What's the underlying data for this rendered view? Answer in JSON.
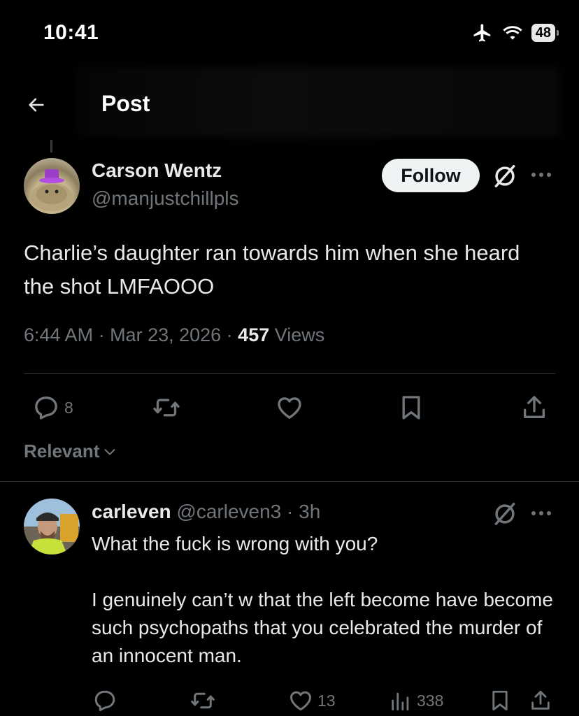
{
  "status_bar": {
    "time": "10:41",
    "battery": "48"
  },
  "header": {
    "title": "Post"
  },
  "post": {
    "author_name": "Carson Wentz",
    "author_handle": "@manjustchillpls",
    "follow_label": "Follow",
    "text": "Charlie’s daughter ran towards him when she heard the shot LMFAOOO",
    "time": "6:44 AM",
    "date": "Mar 23, 2026",
    "views_count": "457",
    "views_label": "Views",
    "reply_count": "8"
  },
  "filter": {
    "label": "Relevant"
  },
  "reply": {
    "name": "carleven",
    "handle": "@carleven3",
    "time": "3h",
    "text_p1": "What the fuck is wrong with you?",
    "text_p2": "I genuinely can’t w that the left become have become such psychopaths that you celebrated the murder of an innocent man.",
    "like_count": "13",
    "view_count": "338"
  },
  "colors": {
    "background": "#000000",
    "text_primary": "#e7e9ea",
    "text_secondary": "#71767b",
    "divider": "#2f3336",
    "button_bg": "#eff3f4"
  },
  "icons": [
    "back-arrow-icon",
    "airplane-icon",
    "wifi-icon",
    "battery-icon",
    "grok-icon",
    "more-icon",
    "reply-icon",
    "repost-icon",
    "like-icon",
    "bookmark-icon",
    "share-icon",
    "chevron-down-icon",
    "views-icon"
  ]
}
